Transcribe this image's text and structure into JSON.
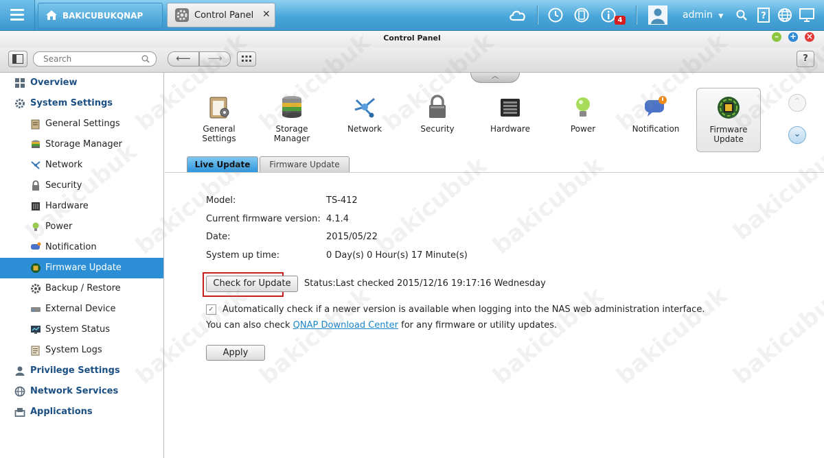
{
  "topbar": {
    "device_name": "BAKICUBUKQNAP",
    "tab_title": "Control Panel",
    "tab_close": "✕",
    "notification_count": "4",
    "user": "admin",
    "user_menu_caret": "▼"
  },
  "window": {
    "title": "Control Panel",
    "minimize": "–",
    "maximize": "+",
    "close": "×"
  },
  "toolbar": {
    "search_placeholder": "Search",
    "back": "⟵",
    "forward": "⟶",
    "help": "?"
  },
  "sidebar": {
    "overview": "Overview",
    "system_settings": "System Settings",
    "items": [
      "General Settings",
      "Storage Manager",
      "Network",
      "Security",
      "Hardware",
      "Power",
      "Notification",
      "Firmware Update",
      "Backup / Restore",
      "External Device",
      "System Status",
      "System Logs"
    ],
    "privilege_settings": "Privilege Settings",
    "network_services": "Network Services",
    "applications": "Applications"
  },
  "categories": [
    {
      "line1": "General",
      "line2": "Settings"
    },
    {
      "line1": "Storage",
      "line2": "Manager"
    },
    {
      "line1": "Network",
      "line2": ""
    },
    {
      "line1": "Security",
      "line2": ""
    },
    {
      "line1": "Hardware",
      "line2": ""
    },
    {
      "line1": "Power",
      "line2": ""
    },
    {
      "line1": "Notification",
      "line2": ""
    },
    {
      "line1": "Firmware",
      "line2": "Update"
    }
  ],
  "subtabs": {
    "live_update": "Live Update",
    "firmware_update": "Firmware Update"
  },
  "info": {
    "model_label": "Model:",
    "model_value": "TS-412",
    "firmware_label": "Current firmware version:",
    "firmware_value": "4.1.4",
    "date_label": "Date:",
    "date_value": "2015/05/22",
    "uptime_label": "System up time:",
    "uptime_value": "0 Day(s) 0 Hour(s) 17 Minute(s)"
  },
  "actions": {
    "check_button": "Check for Update",
    "status": "Status:Last checked 2015/12/16 19:17:16 Wednesday",
    "auto_check_label": "Automatically check if a newer version is available when logging into the NAS web administration interface.",
    "auto_check_checked": true,
    "also_prefix": "You can also check ",
    "download_link": "QNAP Download Center",
    "also_suffix": " for any firmware or utility updates.",
    "apply_button": "Apply"
  },
  "watermark": "bakicubuk",
  "colors": {
    "topbar": "#49a6d9",
    "sidebar_active": "#2c8fd6",
    "link": "#1a84c9",
    "highlight_box": "#c81d1d"
  }
}
